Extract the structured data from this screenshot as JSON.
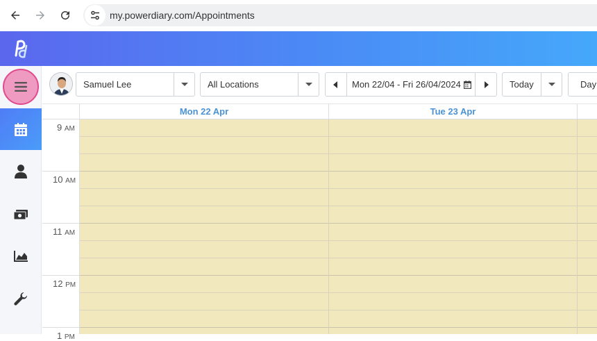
{
  "browser": {
    "url": "my.powerdiary.com/Appointments",
    "back_icon": "arrow-left-icon",
    "forward_icon": "arrow-right-icon",
    "reload_icon": "reload-icon",
    "site_info_icon": "tune-icon"
  },
  "app": {
    "logo_icon": "powerdiary-logo-icon",
    "header_gradient": [
      "#5b67ee",
      "#45a8fa"
    ],
    "accent": "#4a93d6"
  },
  "sidebar": {
    "items": [
      {
        "name": "menu",
        "icon": "hamburger-menu-icon",
        "highlighted": true
      },
      {
        "name": "calendar",
        "icon": "calendar-icon",
        "active": true
      },
      {
        "name": "clients",
        "icon": "person-icon"
      },
      {
        "name": "billing",
        "icon": "money-icon"
      },
      {
        "name": "reports",
        "icon": "area-chart-icon"
      },
      {
        "name": "settings",
        "icon": "wrench-icon"
      }
    ]
  },
  "toolbar": {
    "practitioner": "Samuel Lee",
    "location": "All Locations",
    "date_range": "Mon 22/04 - Fri 26/04/2024",
    "today_label": "Today",
    "view_label": "Day"
  },
  "calendar": {
    "days": [
      "Mon 22 Apr",
      "Tue 23 Apr"
    ],
    "hours": [
      {
        "num": "9",
        "suffix": "AM"
      },
      {
        "num": "10",
        "suffix": "AM"
      },
      {
        "num": "11",
        "suffix": "AM"
      },
      {
        "num": "12",
        "suffix": "PM"
      },
      {
        "num": "1",
        "suffix": "PM"
      }
    ],
    "slot_color": "#f2e8bd"
  }
}
